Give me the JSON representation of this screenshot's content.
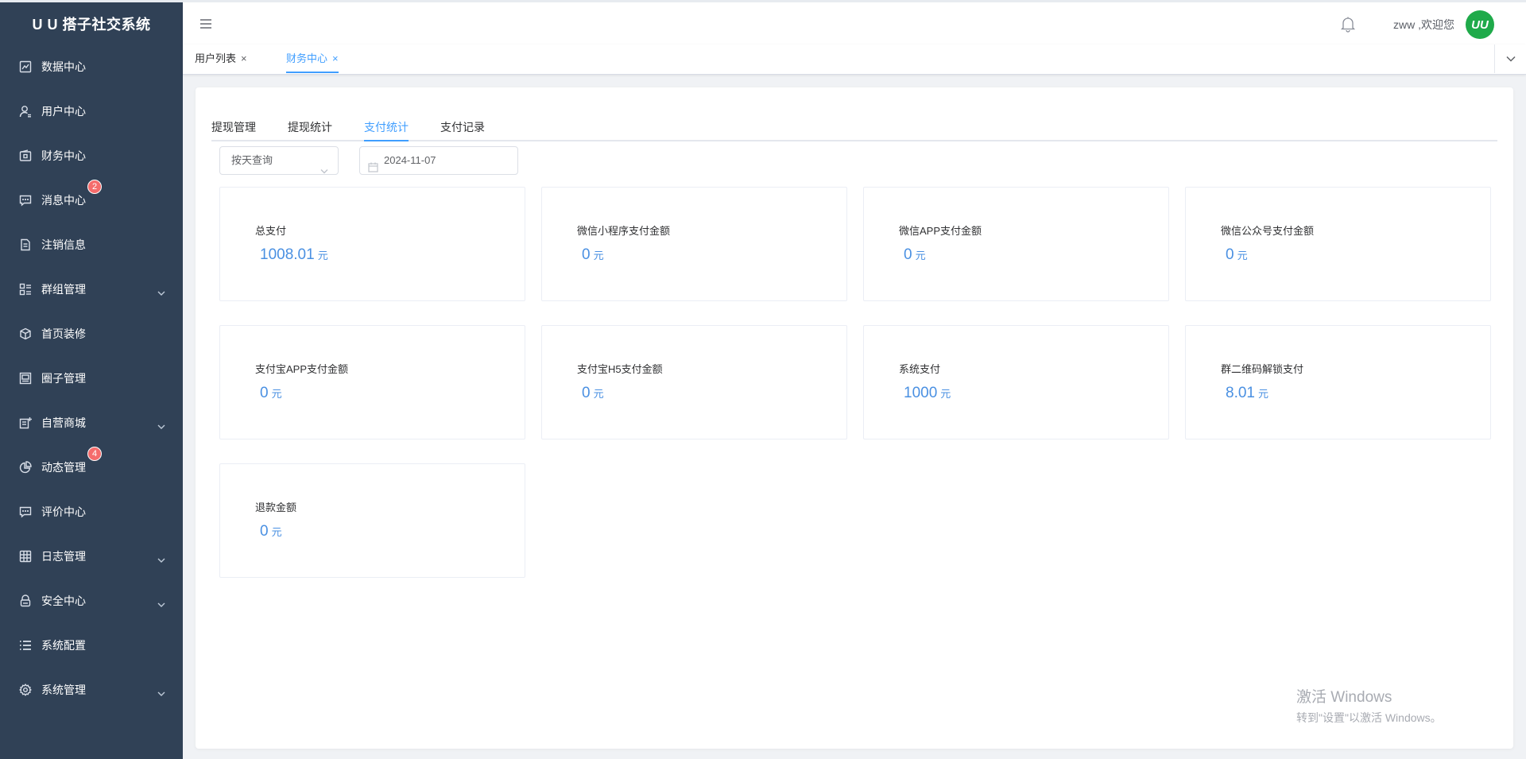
{
  "brand": "U U 搭子社交系统",
  "sidebar": {
    "items": [
      {
        "label": "数据中心",
        "icon": "chart-icon",
        "badge": "",
        "expandable": false
      },
      {
        "label": "用户中心",
        "icon": "user-icon",
        "badge": "",
        "expandable": false
      },
      {
        "label": "财务中心",
        "icon": "wallet-icon",
        "badge": "",
        "expandable": false
      },
      {
        "label": "消息中心",
        "icon": "message-icon",
        "badge": "2",
        "expandable": false
      },
      {
        "label": "注销信息",
        "icon": "document-icon",
        "badge": "",
        "expandable": false
      },
      {
        "label": "群组管理",
        "icon": "group-icon",
        "badge": "",
        "expandable": true
      },
      {
        "label": "首页装修",
        "icon": "cube-icon",
        "badge": "",
        "expandable": false
      },
      {
        "label": "圈子管理",
        "icon": "image-icon",
        "badge": "",
        "expandable": false
      },
      {
        "label": "自营商城",
        "icon": "shop-icon",
        "badge": "",
        "expandable": true
      },
      {
        "label": "动态管理",
        "icon": "pie-icon",
        "badge": "4",
        "expandable": false
      },
      {
        "label": "评价中心",
        "icon": "comment-icon",
        "badge": "",
        "expandable": false
      },
      {
        "label": "日志管理",
        "icon": "table-icon",
        "badge": "",
        "expandable": true
      },
      {
        "label": "安全中心",
        "icon": "lock-icon",
        "badge": "",
        "expandable": true
      },
      {
        "label": "系统配置",
        "icon": "list-icon",
        "badge": "",
        "expandable": false
      },
      {
        "label": "系统管理",
        "icon": "gear-icon",
        "badge": "",
        "expandable": true
      }
    ]
  },
  "header": {
    "welcome": "zww ,欢迎您",
    "avatar_text": "UU"
  },
  "tags": [
    {
      "label": "用户列表",
      "close": "×"
    },
    {
      "label": "财务中心",
      "close": "×"
    }
  ],
  "subtabs": [
    "提现管理",
    "提现统计",
    "支付统计",
    "支付记录"
  ],
  "filters": {
    "mode": "按天查询",
    "date": "2024-11-07"
  },
  "stats": [
    {
      "label": "总支付",
      "value": "1008.01",
      "unit": "元"
    },
    {
      "label": "微信小程序支付金额",
      "value": "0",
      "unit": "元"
    },
    {
      "label": "微信APP支付金额",
      "value": "0",
      "unit": "元"
    },
    {
      "label": "微信公众号支付金额",
      "value": "0",
      "unit": "元"
    },
    {
      "label": "支付宝APP支付金额",
      "value": "0",
      "unit": "元"
    },
    {
      "label": "支付宝H5支付金额",
      "value": "0",
      "unit": "元"
    },
    {
      "label": "系统支付",
      "value": "1000",
      "unit": "元"
    },
    {
      "label": "群二维码解锁支付",
      "value": "8.01",
      "unit": "元"
    },
    {
      "label": "退款金额",
      "value": "0",
      "unit": "元"
    }
  ],
  "watermark": {
    "line1": "激活 Windows",
    "line2": "转到\"设置\"以激活 Windows。"
  }
}
